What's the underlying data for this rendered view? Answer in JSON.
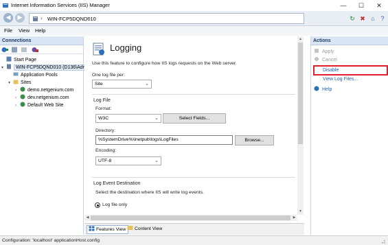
{
  "window": {
    "title": "Internet Information Services (IIS) Manager",
    "controls": {
      "minimize": "—",
      "maximize": "☐",
      "close": "✕"
    }
  },
  "address": {
    "crumb": "WIN-FCP5DQND010"
  },
  "menu": [
    "File",
    "View",
    "Help"
  ],
  "connections": {
    "header": "Connections",
    "tree": [
      {
        "label": "Start Page",
        "icon": "start-page-icon"
      },
      {
        "label": "WIN-FCP5DQND010 (D136\\Adm",
        "icon": "server-icon",
        "selected": true
      },
      {
        "label": "Application Pools",
        "icon": "app-pools-icon"
      },
      {
        "label": "Sites",
        "icon": "folder-icon"
      },
      {
        "label": "demo.netgenium.com",
        "icon": "globe-icon"
      },
      {
        "label": "dev.netgenium.com",
        "icon": "globe-icon"
      },
      {
        "label": "Default Web Site",
        "icon": "globe-icon"
      }
    ]
  },
  "feature": {
    "title": "Logging",
    "description": "Use this feature to configure how IIS logs requests on the Web server.",
    "one_log_label": "One log file per:",
    "one_log_value": "Site",
    "log_file_group": "Log File",
    "format_label": "Format:",
    "format_value": "W3C",
    "select_fields_button": "Select Fields...",
    "directory_label": "Directory:",
    "directory_value": "%SystemDrive%\\inetpub\\logs\\LogFiles",
    "browse_button": "Browse...",
    "encoding_label": "Encoding:",
    "encoding_value": "UTF-8",
    "event_group": "Log Event Destination",
    "event_desc": "Select the destination where IIS will write log events.",
    "radio_label": "Log file only"
  },
  "view_tabs": {
    "features": "Features View",
    "content": "Content View"
  },
  "actions": {
    "header": "Actions",
    "items": [
      {
        "label": "Apply",
        "state": "disabled"
      },
      {
        "label": "Cancel",
        "state": "disabled"
      },
      {
        "label": "Disable",
        "state": "link"
      },
      {
        "label": "View Log Files...",
        "state": "link"
      },
      {
        "label": "Help",
        "state": "link"
      }
    ]
  },
  "status": "Configuration: 'localhost' applicationHost.config",
  "colors": {
    "accent": "#1e5fb4",
    "highlight": "#e0202a",
    "panel_header": "#dbe6f4"
  }
}
